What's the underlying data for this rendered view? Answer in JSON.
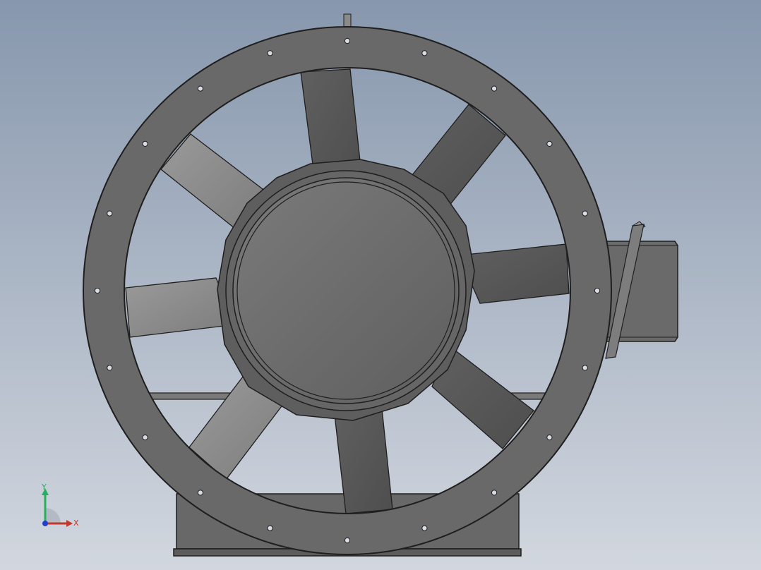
{
  "viewport": {
    "background_top": "#8797ad",
    "background_bottom": "#d2d7df"
  },
  "model": {
    "body_color": "#6b6b6b",
    "edge_color": "#1e1e1e",
    "blade_count": 8,
    "bolt_hole_count": 20
  },
  "triad": {
    "x_label": "X",
    "y_label": "Y",
    "x_color": "#c0392b",
    "y_color": "#27ae60",
    "z_color": "#1f3fd0"
  }
}
